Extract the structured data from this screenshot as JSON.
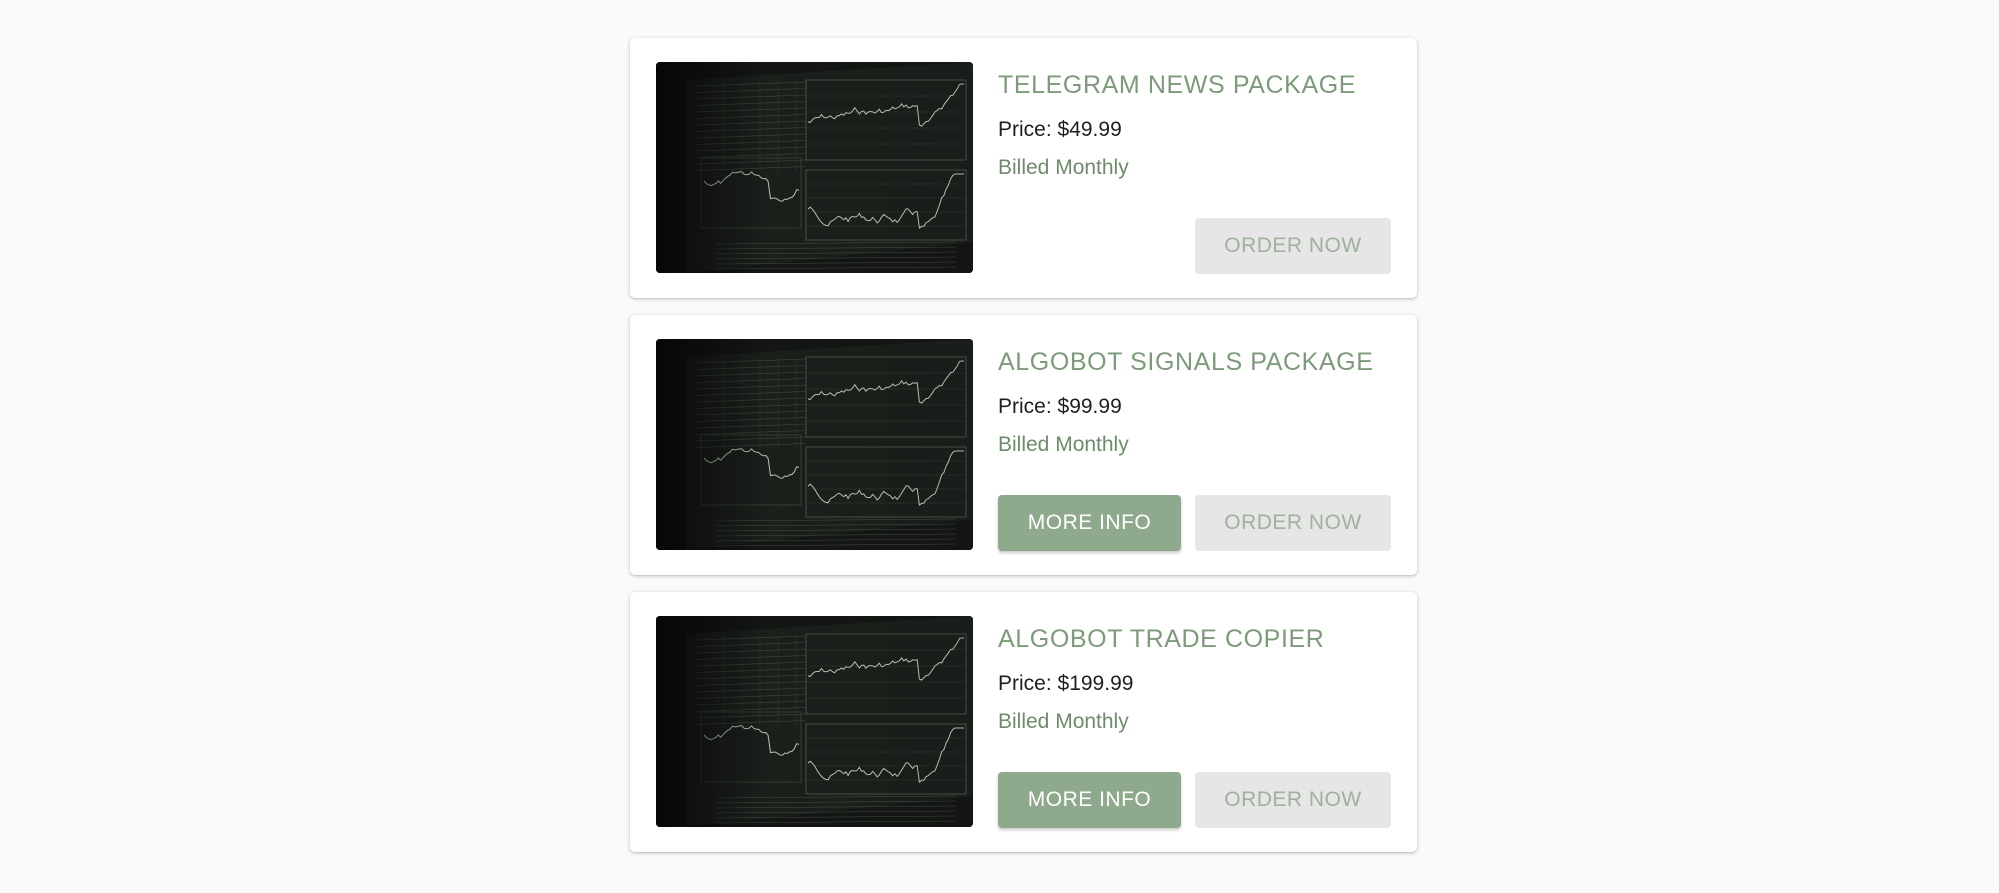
{
  "theme": {
    "accent": "#8fa98c",
    "title_color": "#7d9a7a",
    "disabled_bg": "#e6e6e6",
    "disabled_text": "#9fb19c"
  },
  "packages": [
    {
      "title": "TELEGRAM NEWS PACKAGE",
      "price": "Price: $49.99",
      "billing": "Billed Monthly",
      "more_info_label": null,
      "order_label": "ORDER NOW",
      "order_enabled": false,
      "image_icon": "trading-chart-image"
    },
    {
      "title": "ALGOBOT SIGNALS PACKAGE",
      "price": "Price: $99.99",
      "billing": "Billed Monthly",
      "more_info_label": "MORE INFO",
      "order_label": "ORDER NOW",
      "order_enabled": false,
      "image_icon": "trading-chart-image"
    },
    {
      "title": "ALGOBOT TRADE COPIER",
      "price": "Price: $199.99",
      "billing": "Billed Monthly",
      "more_info_label": "MORE INFO",
      "order_label": "ORDER NOW",
      "order_enabled": false,
      "image_icon": "trading-chart-image"
    }
  ]
}
